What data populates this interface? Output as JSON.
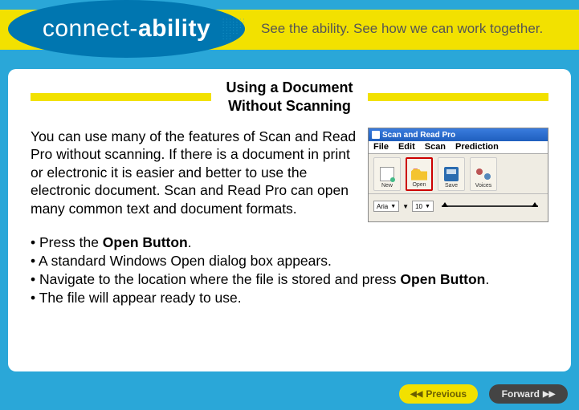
{
  "logo": {
    "part1": "connect-",
    "part2": "ability"
  },
  "tagline": "See the ability. See how we can work together.",
  "slide": {
    "title_line1": "Using a Document",
    "title_line2": "Without Scanning",
    "paragraph": "You can use many of the features of Scan and Read Pro without scanning.  If there is a document in print or electronic it is easier and better to use the electronic document. Scan and Read Pro can open many common text and document formats.",
    "steps": {
      "s1_a": "Press the ",
      "s1_b": "Open Button",
      "s1_c": ".",
      "s2": "A standard Windows Open dialog box appears.",
      "s3_a": "Navigate to the location where the file is stored and press ",
      "s3_b": "Open Button",
      "s3_c": ".",
      "s4": "The file will appear ready to use."
    }
  },
  "screenshot": {
    "window_title": "Scan and Read Pro",
    "menu": {
      "file": "File",
      "edit": "Edit",
      "scan": "Scan",
      "prediction": "Prediction"
    },
    "toolbar": {
      "new": "New",
      "open": "Open",
      "save": "Save",
      "voices": "Voices"
    },
    "lower": {
      "font": "Aria",
      "size": "10"
    }
  },
  "nav": {
    "previous": "Previous",
    "forward": "Forward"
  }
}
